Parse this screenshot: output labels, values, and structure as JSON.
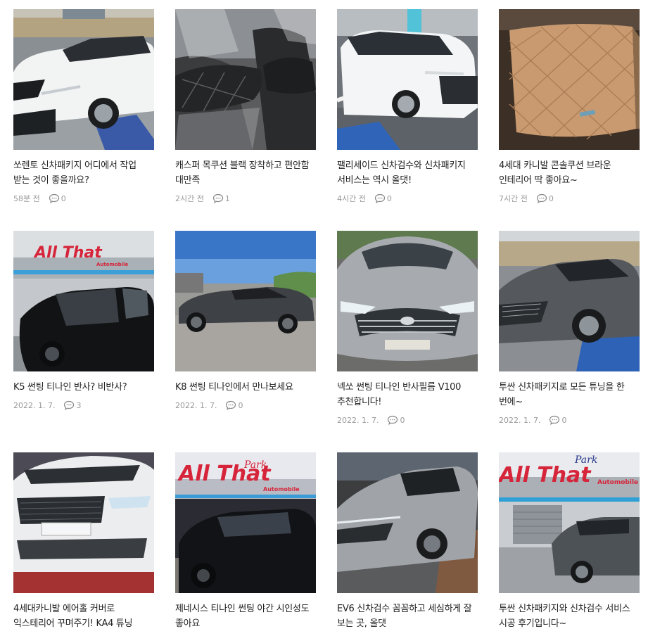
{
  "posts": [
    {
      "title": "쏘렌토 신차패키지 어디에서 작업 받는 것이 좋을까요?",
      "date": "58분 전",
      "comments": "0",
      "image": "white-suv-sorento"
    },
    {
      "title": "캐스퍼 목쿠션 블랙 장착하고 편안함 대만족",
      "date": "2시간 전",
      "comments": "1",
      "image": "black-neck-cushion"
    },
    {
      "title": "팰리세이드 신차검수와 신차패키지 서비스는 역시 올댓!",
      "date": "4시간 전",
      "comments": "0",
      "image": "white-suv-palisade"
    },
    {
      "title": "4세대 카니발 콘솔쿠션 브라운 인테리어 딱 좋아요~",
      "date": "7시간 전",
      "comments": "0",
      "image": "brown-console-cushion"
    },
    {
      "title": "K5 썬팅 티나인 반사? 비반사?",
      "date": "2022. 1. 7.",
      "comments": "3",
      "image": "black-sedan-k5-storefront"
    },
    {
      "title": "K8 썬팅 티나인에서 만나보세요",
      "date": "2022. 1. 7.",
      "comments": "0",
      "image": "gray-sedan-k8"
    },
    {
      "title": "넥쏘 썬팅 티나인 반사필름 V100 추천합니다!",
      "date": "2022. 1. 7.",
      "comments": "0",
      "image": "silver-suv-nexo-front"
    },
    {
      "title": "투싼 신차패키지로 모든 튜닝을 한 번에~",
      "date": "2022. 1. 7.",
      "comments": "0",
      "image": "gray-suv-tucson"
    },
    {
      "title": "4세대카니발 에어홀 커버로 익스테리어 꾸며주기! KA4 튜닝",
      "date": "",
      "comments": "",
      "image": "white-van-carnival-front"
    },
    {
      "title": "제네시스 티나인 썬팅 야간 시인성도 좋아요",
      "date": "",
      "comments": "",
      "image": "black-suv-genesis-night"
    },
    {
      "title": "EV6 신차검수 꼼꼼하고 세심하게 잘 보는 곳, 올댓",
      "date": "",
      "comments": "",
      "image": "silver-ev6"
    },
    {
      "title": "투싼 신차패키지와 신차검수 서비스 시공 후기입니다~",
      "date": "",
      "comments": "",
      "image": "gray-suv-tucson-storefront"
    }
  ],
  "store_sign": {
    "text1": "All That",
    "text2": "Park",
    "text3": "Automobile"
  },
  "colors": {
    "title": "#222222",
    "meta": "#999999",
    "sign_red": "#d6253a",
    "sign_blue": "#2b3b8f"
  }
}
